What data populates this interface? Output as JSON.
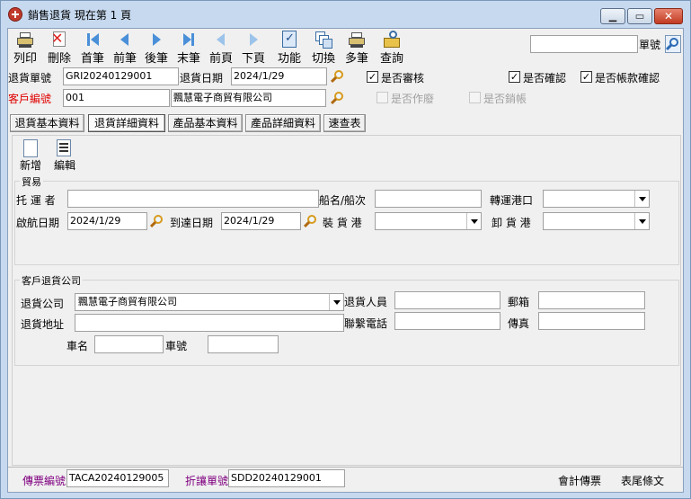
{
  "window": {
    "title": "銷售退貨  現在第 1 頁"
  },
  "toolbar": {
    "items": [
      {
        "label": "列印"
      },
      {
        "label": "刪除"
      },
      {
        "label": "首筆"
      },
      {
        "label": "前筆"
      },
      {
        "label": "後筆"
      },
      {
        "label": "末筆"
      },
      {
        "label": "前頁"
      },
      {
        "label": "下頁"
      },
      {
        "label": "功能"
      },
      {
        "label": "切換"
      },
      {
        "label": "多筆"
      },
      {
        "label": "查詢"
      }
    ],
    "search_label": "單號",
    "search_value": ""
  },
  "header": {
    "return_no_label": "退貨單號",
    "return_no": "GRI20240129001",
    "return_date_label": "退貨日期",
    "return_date": "2024/1/29",
    "customer_no_label": "客戶編號",
    "customer_no": "001",
    "customer_name": "飄慧電子商貿有限公司",
    "audit_label": "是否審核",
    "audit_checked": "✓",
    "confirm_label": "是否確認",
    "confirm_checked": "✓",
    "payment_confirm_label": "是否帳款確認",
    "payment_confirm_checked": "✓",
    "void_label": "是否作廢",
    "writeoff_label": "是否銷帳"
  },
  "tabs": [
    {
      "label": "退貨基本資料"
    },
    {
      "label": "退貨詳細資料"
    },
    {
      "label": "產品基本資料"
    },
    {
      "label": "產品詳細資料"
    },
    {
      "label": "速查表"
    }
  ],
  "actions": {
    "add_label": "新增",
    "edit_label": "編輯"
  },
  "trade": {
    "group_title": "貿易",
    "carrier_label": "托 運 者",
    "carrier": "",
    "vessel_label": "船名/船次",
    "vessel": "",
    "transit_port_label": "轉運港口",
    "transit_port": "",
    "sail_date_label": "啟航日期",
    "sail_date": "2024/1/29",
    "arrive_date_label": "到達日期",
    "arrive_date": "2024/1/29",
    "loading_port_label": "裝 貨 港",
    "loading_port": "",
    "unloading_port_label": "卸 貨 港",
    "unloading_port": ""
  },
  "customer_return": {
    "group_title": "客戶退貨公司",
    "company_label": "退貨公司",
    "company": "飄慧電子商貿有限公司",
    "person_label": "退貨人員",
    "person": "",
    "postal_label": "郵箱",
    "postal": "",
    "address_label": "退貨地址",
    "address": "",
    "phone_label": "聯繫電話",
    "phone": "",
    "fax_label": "傳真",
    "fax": "",
    "car_name_label": "車名",
    "car_name": "",
    "car_no_label": "車號",
    "car_no": ""
  },
  "footer": {
    "voucher_no_label": "傳票編號",
    "voucher_no": "TACA20240129005",
    "allowance_no_label": "折讓單號",
    "allowance_no": "SDD20240129001",
    "accounting_voucher_label": "會計傳票",
    "footer_text_label": "表尾條文"
  }
}
